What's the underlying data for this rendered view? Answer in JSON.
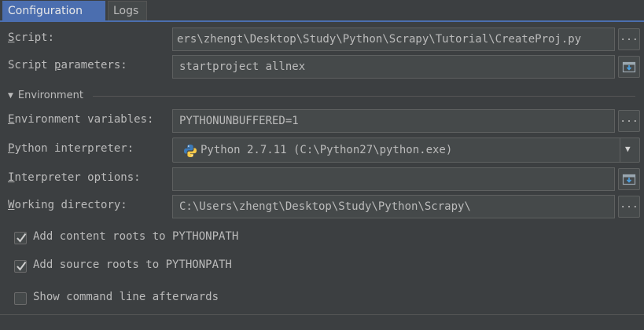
{
  "tabs": [
    {
      "label": "Configuration",
      "active": true
    },
    {
      "label": "Logs",
      "active": false
    }
  ],
  "form": {
    "script": {
      "label_mnemonic": "S",
      "label_rest": "cript:",
      "value": "ers\\zhengt\\Desktop\\Study\\Python\\Scrapy\\Tutorial\\CreateProj.py"
    },
    "script_parameters": {
      "label_pre": "Script ",
      "label_mnemonic": "p",
      "label_rest": "arameters:",
      "value": "startproject allnex"
    },
    "environment_section": "Environment",
    "environment_variables": {
      "label_mnemonic": "E",
      "label_rest": "nvironment variables:",
      "value": "PYTHONUNBUFFERED=1"
    },
    "python_interpreter": {
      "label_mnemonic": "P",
      "label_rest": "ython interpreter:",
      "value": "Python 2.7.11 (C:\\Python27\\python.exe)"
    },
    "interpreter_options": {
      "label_mnemonic": "I",
      "label_rest": "nterpreter options:",
      "value": ""
    },
    "working_directory": {
      "label_mnemonic": "W",
      "label_rest": "orking directory:",
      "value": "C:\\Users\\zhengt\\Desktop\\Study\\Python\\Scrapy\\"
    },
    "browse_label": "...",
    "checkboxes": [
      {
        "label": "Add content roots to PYTHONPATH",
        "checked": true
      },
      {
        "label": "Add source roots to PYTHONPATH",
        "checked": true
      },
      {
        "label": "Show command line afterwards",
        "checked": false
      }
    ]
  },
  "colors": {
    "background": "#3c3f41",
    "accent": "#4b6eaf",
    "field": "#45494a",
    "text": "#bbbbbb"
  },
  "icons": [
    "browse-icon",
    "expand-icon",
    "python-icon",
    "chevron-down-icon",
    "checkmark-icon",
    "triangle-down-icon"
  ]
}
